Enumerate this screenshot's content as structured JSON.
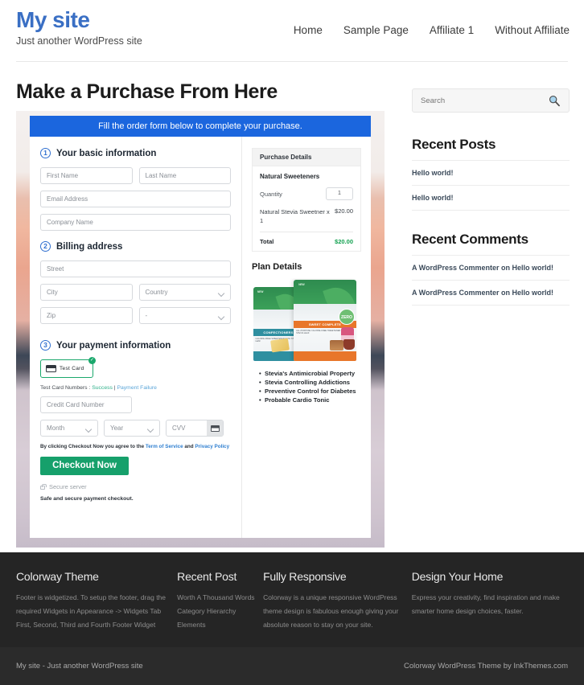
{
  "header": {
    "site_title": "My site",
    "tagline": "Just another WordPress site",
    "nav": [
      {
        "label": "Home"
      },
      {
        "label": "Sample Page"
      },
      {
        "label": "Affiliate 1"
      },
      {
        "label": "Without Affiliate"
      }
    ]
  },
  "main": {
    "page_title": "Make a Purchase From Here",
    "banner": "Fill the order form below to complete your purchase.",
    "steps": {
      "step1": {
        "num": "1",
        "title": "Your basic information"
      },
      "step2": {
        "num": "2",
        "title": "Billing address"
      },
      "step3": {
        "num": "3",
        "title": "Your payment information"
      }
    },
    "fields": {
      "first_name": "First Name",
      "last_name": "Last Name",
      "email": "Email Address",
      "company": "Company Name",
      "street": "Street",
      "city": "City",
      "country": "Country",
      "zip": "Zip",
      "state": "-",
      "credit_card": "Credit Card Number",
      "month": "Month",
      "year": "Year",
      "cvv": "CVV"
    },
    "payment": {
      "card_option_label": "Test  Card",
      "card_check": "✓",
      "test_numbers_prefix": "Test Card Numbers : ",
      "test_success": "Success",
      "test_divider": " | ",
      "test_failure": "Payment Failure",
      "terms_prefix": "By clicking Checkout Now you agree to the ",
      "terms_link": "Term of Service",
      "terms_and": " and ",
      "privacy_link": "Privacy Policy",
      "checkout_label": "Checkout Now",
      "secure_server": "Secure server",
      "safe_note": "Safe and secure payment checkout."
    },
    "purchase_details": {
      "heading": "Purchase Details",
      "product": "Natural Sweeteners",
      "quantity_label": "Quantity",
      "quantity_value": "1",
      "line_item_name": "Natural Stevia Sweetner x 1",
      "line_item_value": "$20.00",
      "total_label": "Total",
      "total_value": "$20.00"
    },
    "plan_details": {
      "heading": "Plan Details",
      "pouch1_name": "CONFECTIONERS",
      "pouch1_sub": "CALORIE-FREE SWEETENER WITH STEVIA LEAF",
      "pouch2_name": "SWEET COMPLETE",
      "pouch2_sub": "ALL-PURPOSE CALORIE-FREE SWEETENER FROM THE STEVIA LEAF",
      "new_tag": "NEW",
      "zero_tag": "ZERO",
      "bullets": [
        "Stevia's Antimicrobial Property",
        "Stevia Controlling Addictions",
        "Preventive Control for Diabetes",
        "Probable Cardio Tonic"
      ]
    }
  },
  "sidebar": {
    "search_placeholder": "Search",
    "recent_posts_title": "Recent Posts",
    "recent_posts": [
      {
        "label": "Hello world!"
      },
      {
        "label": "Hello world!"
      }
    ],
    "recent_comments_title": "Recent Comments",
    "recent_comments": [
      {
        "label": "A WordPress Commenter on Hello world!"
      },
      {
        "label": "A WordPress Commenter on Hello world!"
      }
    ]
  },
  "footer": {
    "columns": [
      {
        "title": "Colorway Theme",
        "text": "Footer is widgetized. To setup the footer, drag the required Widgets in Appearance -> Widgets Tab First, Second, Third and Fourth Footer Widget"
      },
      {
        "title": "Recent Post",
        "items": [
          {
            "label": "Worth A Thousand Words"
          },
          {
            "label": "Category Hierarchy"
          },
          {
            "label": "Elements"
          }
        ]
      },
      {
        "title": "Fully Responsive",
        "text": "Colorway is a unique responsive WordPress theme design is fabulous enough giving your absolute reason to stay on your site."
      },
      {
        "title": "Design Your Home",
        "text": "Express your creativity, find inspiration and make smarter home design choices, faster."
      }
    ],
    "bottom_left": "My site - Just another WordPress site",
    "bottom_right": "Colorway WordPress Theme by InkThemes.com"
  },
  "colors": {
    "brand_blue": "#3a6fc4",
    "banner_blue": "#1b66de",
    "checkout_green": "#16a06b",
    "total_green": "#12a150",
    "footer_dark": "#252525",
    "footer_bottom": "#2b2b2b"
  }
}
